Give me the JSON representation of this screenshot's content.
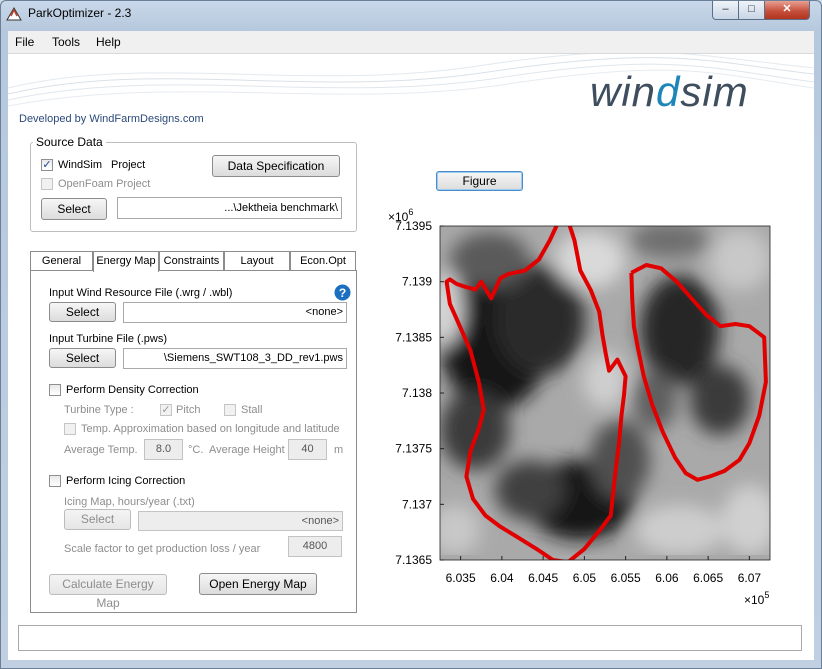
{
  "window": {
    "title": "ParkOptimizer - 2.3",
    "controls": [
      "–",
      "□",
      "✕"
    ]
  },
  "menu": {
    "items": [
      "File",
      "Tools",
      "Help"
    ]
  },
  "banner": {
    "brand_part1": "win",
    "brand_part2": "d",
    "brand_part3": "sim",
    "developer": "Developed by WindFarmDesigns.com"
  },
  "source_data": {
    "legend": "Source Data",
    "windsim_label": "WindSim",
    "windsim_suffix": "Project",
    "windsim_checked": true,
    "openfoam_label": "OpenFoam Project",
    "openfoam_checked": false,
    "data_spec_button": "Data Specification",
    "select_button": "Select",
    "path": "...\\Jektheia benchmark\\"
  },
  "tabs": [
    "General",
    "Energy Map",
    "Constraints",
    "Layout",
    "Econ.Opt"
  ],
  "energy_map": {
    "wind_resource_label": "Input Wind Resource File (.wrg / .wbl)",
    "wind_resource_value": "<none>",
    "turbine_label": "Input Turbine File (.pws)",
    "turbine_value": "\\Siemens_SWT108_3_DD_rev1.pws",
    "select_label": "Select",
    "help_icon_text": "?",
    "density_label": "Perform Density Correction",
    "turbine_type_label": "Turbine Type :",
    "pitch_label": "Pitch",
    "stall_label": "Stall",
    "temp_approx_label": "Temp. Approximation based on longitude and latitude",
    "avg_temp_label": "Average Temp.",
    "avg_temp_value": "8.0",
    "temp_unit": "°C.",
    "avg_height_label": "Average Height",
    "avg_height_value": "40",
    "height_unit": "m",
    "icing_label": "Perform Icing Correction",
    "icing_map_label": "Icing Map, hours/year (.txt)",
    "icing_map_value": "<none>",
    "scale_label": "Scale factor to get production loss / year",
    "scale_value": "4800",
    "calc_button": "Calculate Energy Map",
    "open_button": "Open Energy Map"
  },
  "figure_button": "Figure",
  "colors": {
    "boundary": "#e00000",
    "accent": "#1d86b8",
    "brand_dark": "#3e4e5e"
  },
  "chart_data": {
    "type": "heatmap",
    "xlim": [
      6.0325,
      6.0725
    ],
    "ylim": [
      7.1365,
      7.1395
    ],
    "x_ticks": [
      6.035,
      6.04,
      6.045,
      6.05,
      6.055,
      6.06,
      6.065,
      6.07
    ],
    "x_tick_labels": [
      "6.035",
      "6.04",
      "6.045",
      "6.05",
      "6.055",
      "6.06",
      "6.065",
      "6.07"
    ],
    "y_ticks": [
      7.1365,
      7.137,
      7.1375,
      7.138,
      7.1385,
      7.139,
      7.1395
    ],
    "y_tick_labels": [
      "7.1365",
      "7.137",
      "7.1375",
      "7.138",
      "7.1385",
      "7.139",
      "7.1395"
    ],
    "x_exponent_base": "×10",
    "x_exponent": "5",
    "y_exponent_base": "×10",
    "y_exponent": "6",
    "colormap": "gray",
    "boundary_color": "#e00000",
    "boundaries": [
      {
        "x": [
          6.0357,
          6.0368,
          6.0375,
          6.0387,
          6.0398,
          6.0408,
          6.0428,
          6.0445,
          6.0458,
          6.0468,
          6.0478,
          6.0488,
          6.0495,
          6.0508,
          6.0518,
          6.0522,
          6.0526,
          6.053,
          6.054,
          6.055,
          6.0548,
          6.0545,
          6.0542,
          6.0537,
          6.0532,
          6.052,
          6.05,
          6.048,
          6.0462,
          6.0442,
          6.042,
          6.0398,
          6.038,
          6.0365,
          6.0357,
          6.0362,
          6.0372,
          6.0378,
          6.0372,
          6.0362,
          6.0352,
          6.0343,
          6.0337,
          6.0333,
          6.0337,
          6.0345,
          6.0357
        ],
        "y": [
          7.13895,
          7.13893,
          7.139,
          7.13885,
          7.13903,
          7.13907,
          7.1391,
          7.1392,
          7.13937,
          7.13953,
          7.1396,
          7.13937,
          7.1391,
          7.13892,
          7.13873,
          7.13852,
          7.13835,
          7.1382,
          7.1383,
          7.13815,
          7.13798,
          7.1378,
          7.13755,
          7.13725,
          7.1369,
          7.13678,
          7.1366,
          7.13648,
          7.1365,
          7.1366,
          7.1367,
          7.1368,
          7.1369,
          7.13705,
          7.13725,
          7.13748,
          7.13768,
          7.13785,
          7.1381,
          7.13838,
          7.13855,
          7.1387,
          7.1388,
          7.139,
          7.13902,
          7.13898,
          7.13895
        ]
      },
      {
        "x": [
          6.0557,
          6.0575,
          6.0593,
          6.0612,
          6.063,
          6.0648,
          6.0665,
          6.0683,
          6.07,
          6.0718,
          6.072,
          6.0712,
          6.07,
          6.0688,
          6.067,
          6.0652,
          6.0637,
          6.0623,
          6.061,
          6.0595,
          6.0582,
          6.0572,
          6.0565,
          6.056,
          6.0558,
          6.0557
        ],
        "y": [
          7.13908,
          7.13915,
          7.13912,
          7.139,
          7.13885,
          7.1387,
          7.1386,
          7.13862,
          7.1386,
          7.1385,
          7.1381,
          7.1378,
          7.13755,
          7.1374,
          7.1373,
          7.13725,
          7.13722,
          7.13728,
          7.13742,
          7.13765,
          7.1379,
          7.13815,
          7.1384,
          7.1386,
          7.13885,
          7.13908
        ]
      }
    ]
  }
}
